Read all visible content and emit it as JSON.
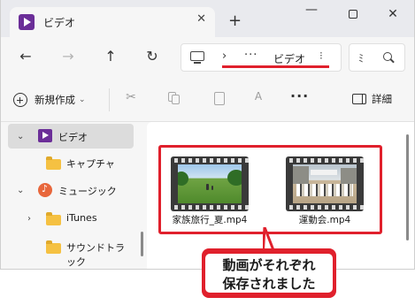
{
  "titlebar": {
    "tab_title": "ビデオ",
    "tab_close": "✕",
    "new_tab": "+",
    "minimize": "—",
    "close": "✕"
  },
  "navbar": {
    "back": "←",
    "forward": "→",
    "up": "↑",
    "refresh": "↻",
    "address": {
      "separator": "›",
      "more": "···",
      "current": "ビデオ",
      "chevron": "⁝"
    },
    "search_text": "ﾐ"
  },
  "toolbar": {
    "new_label": "新規作成",
    "new_chevron": "⌄",
    "cut": "✂",
    "rename": "A",
    "more": "···",
    "details_label": "詳細"
  },
  "sidebar": {
    "items": [
      {
        "label": "ビデオ",
        "icon": "video-icon",
        "chevron": "⌄",
        "selected": true
      },
      {
        "label": "キャプチャ",
        "icon": "folder-icon"
      },
      {
        "label": "ミュージック",
        "icon": "music-icon",
        "chevron": "⌄"
      },
      {
        "label": "iTunes",
        "icon": "folder-icon",
        "chevron": "›"
      },
      {
        "label": "サウンドトラック",
        "icon": "folder-icon"
      }
    ]
  },
  "files": [
    {
      "name": "家族旅行_夏.mp4",
      "thumbnail": "park-scene"
    },
    {
      "name": "運動会.mp4",
      "thumbnail": "event-scene"
    }
  ],
  "callout": {
    "line1": "動画がそれぞれ",
    "line2": "保存されました"
  },
  "colors": {
    "accent_red": "#e0202c",
    "video_purple": "#6b2e98",
    "folder_yellow": "#f5c142"
  }
}
